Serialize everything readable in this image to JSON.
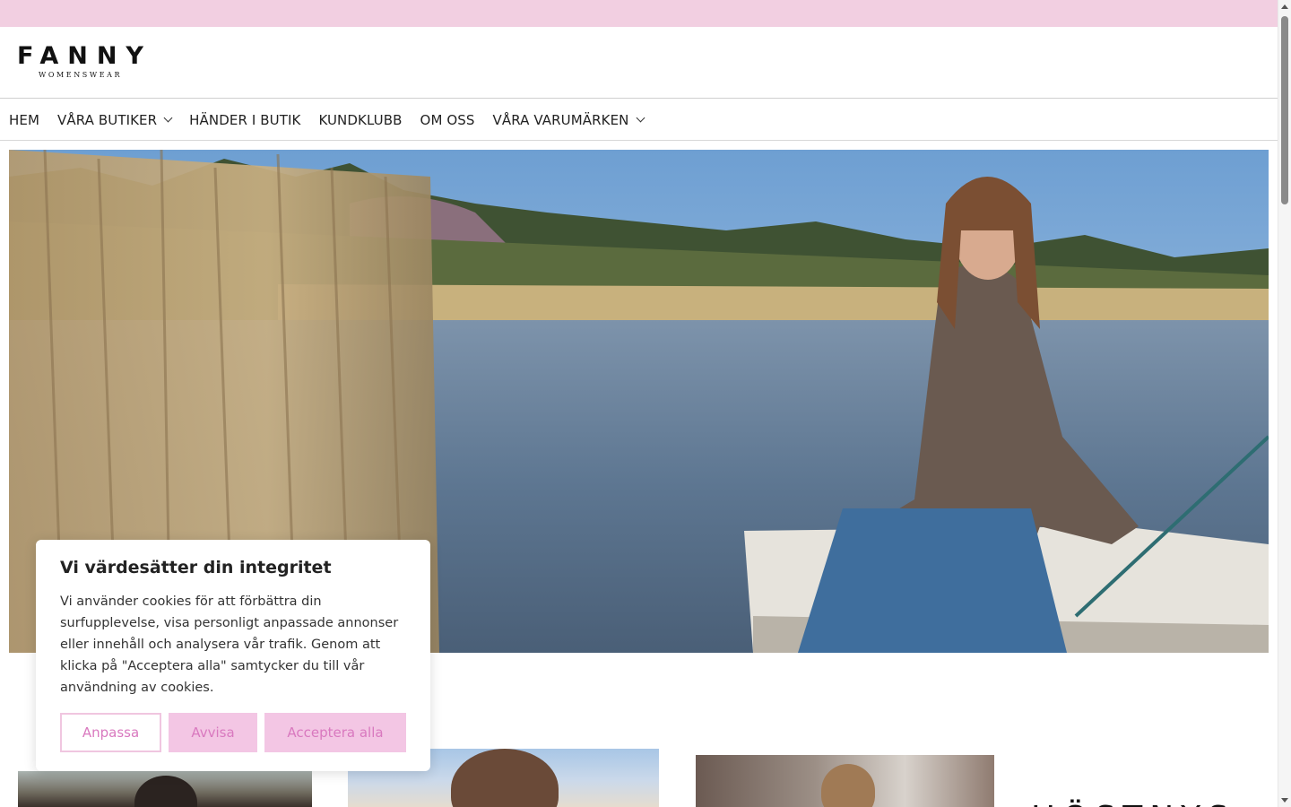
{
  "brand": {
    "name": "FANNY",
    "tagline": "WOMENSWEAR"
  },
  "nav": {
    "items": [
      {
        "label": "HEM",
        "has_dropdown": false
      },
      {
        "label": "VÅRA BUTIKER",
        "has_dropdown": true
      },
      {
        "label": "HÄNDER I BUTIK",
        "has_dropdown": false
      },
      {
        "label": "KUNDKLUBB",
        "has_dropdown": false
      },
      {
        "label": "OM OSS",
        "has_dropdown": false
      },
      {
        "label": "VÅRA VARUMÄRKEN",
        "has_dropdown": true
      }
    ]
  },
  "hero": {
    "image": "woman-on-boat-by-lake"
  },
  "products": {
    "section_heading": "HÖSTNYS"
  },
  "cookie": {
    "title": "Vi värdesätter din integritet",
    "text": "Vi använder cookies för att förbättra din surfupplevelse, visa personligt anpassade annonser eller innehåll och analysera vår trafik. Genom att klicka på \"Acceptera alla\" samtycker du till vår användning av cookies.",
    "customize_label": "Anpassa",
    "reject_label": "Avvisa",
    "accept_label": "Acceptera alla"
  },
  "colors": {
    "announcement_bar": "#f2cfe1",
    "button_pink": "#f3c6e4",
    "button_text": "#d979bf"
  }
}
